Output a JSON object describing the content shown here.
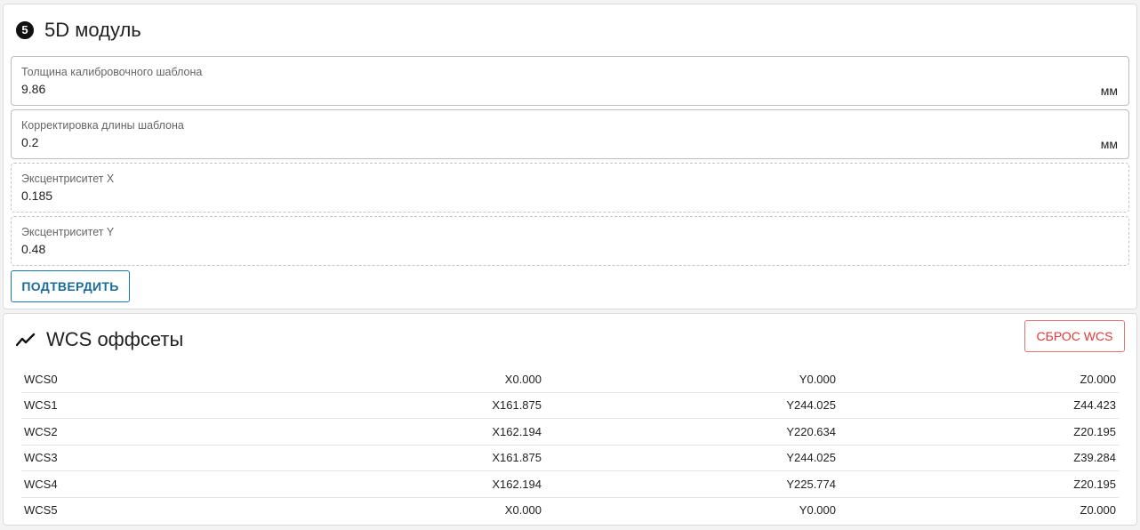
{
  "module_5d": {
    "title": "5D модуль",
    "icon": "number-five-circle-icon",
    "fields": [
      {
        "label": "Толщина калибровочного шаблона",
        "value": "9.86",
        "suffix": "мм"
      },
      {
        "label": "Корректировка длины шаблона",
        "value": "0.2",
        "suffix": "мм"
      },
      {
        "label": "Эксцентриситет X",
        "value": "0.185"
      },
      {
        "label": "Эксцентриситет Y",
        "value": "0.48"
      }
    ],
    "confirm_label": "ПОДТВЕРДИТЬ"
  },
  "wcs": {
    "title": "WCS оффсеты",
    "icon": "trending-line-icon",
    "reset_label": "СБРОС WCS",
    "rows": [
      {
        "name": "WCS0",
        "x": "X0.000",
        "y": "Y0.000",
        "z": "Z0.000"
      },
      {
        "name": "WCS1",
        "x": "X161.875",
        "y": "Y244.025",
        "z": "Z44.423"
      },
      {
        "name": "WCS2",
        "x": "X162.194",
        "y": "Y220.634",
        "z": "Z20.195"
      },
      {
        "name": "WCS3",
        "x": "X161.875",
        "y": "Y244.025",
        "z": "Z39.284"
      },
      {
        "name": "WCS4",
        "x": "X162.194",
        "y": "Y225.774",
        "z": "Z20.195"
      },
      {
        "name": "WCS5",
        "x": "X0.000",
        "y": "Y0.000",
        "z": "Z0.000"
      }
    ]
  },
  "colors": {
    "primary": "#1b6d99",
    "danger": "#e53935"
  }
}
